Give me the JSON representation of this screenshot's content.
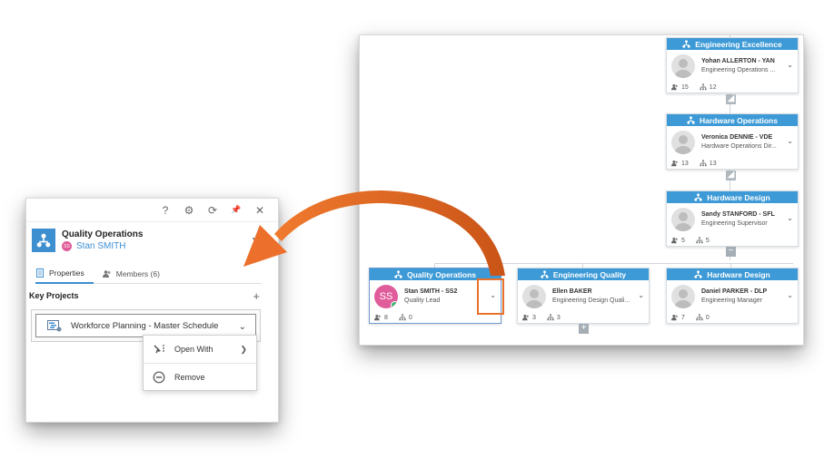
{
  "org_chart": {
    "cards": [
      {
        "id": "eng-excellence",
        "header": "Engineering Excellence",
        "name": "Yohan ALLERTON - YAN",
        "title": "Engineering Operations ...",
        "members": "15",
        "children": "12"
      },
      {
        "id": "hw-ops",
        "header": "Hardware Operations",
        "name": "Veronica DENNIE - VDE",
        "title": "Hardware Operations Dir...",
        "members": "13",
        "children": "13"
      },
      {
        "id": "hw-design-top",
        "header": "Hardware Design",
        "name": "Sandy STANFORD - SFL",
        "title": "Engineering Supervisor",
        "members": "5",
        "children": "5"
      },
      {
        "id": "quality-ops",
        "header": "Quality Operations",
        "name": "Stan SMITH - SS2",
        "title": "Quality Lead",
        "members": "8",
        "children": "0",
        "avatar_initials": "SS"
      },
      {
        "id": "eng-quality",
        "header": "Engineering Quality",
        "name": "Ellen BAKER",
        "title": "Engineering Design Quali...",
        "members": "3",
        "children": "3"
      },
      {
        "id": "hw-design-bottom",
        "header": "Hardware Design",
        "name": "Daniel PARKER - DLP",
        "title": "Engineering Manager",
        "members": "7",
        "children": "0"
      }
    ],
    "expanders": {
      "collapse": "−",
      "expand": "+"
    }
  },
  "properties_panel": {
    "toolbar": {
      "help": "?",
      "settings": "⚙",
      "refresh": "⟳",
      "pin": "📌",
      "close": "✕"
    },
    "title": "Quality Operations",
    "owner_initials": "SS",
    "owner_name": "Stan SMITH",
    "close_label": "✕",
    "tabs": [
      {
        "label": "Properties"
      },
      {
        "label": "Members (6)"
      }
    ],
    "key_projects_label": "Key Projects",
    "add_label": "+",
    "project_name": "Workforce Planning - Master Schedule",
    "context_menu": [
      {
        "label": "Open With",
        "has_submenu": true
      },
      {
        "label": "Remove",
        "has_submenu": false
      }
    ]
  },
  "colors": {
    "header_blue": "#3d9ad6",
    "accent_orange": "#e8702a",
    "avatar_pink": "#e05c9a",
    "link_blue": "#3b8fd4"
  }
}
